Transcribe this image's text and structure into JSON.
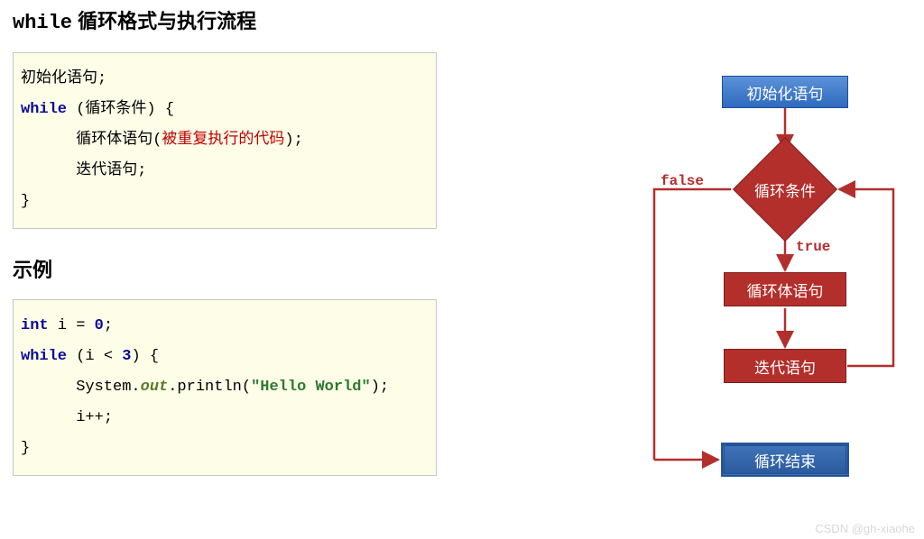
{
  "title": {
    "mono": "while",
    "rest": " 循环格式与执行流程"
  },
  "code1": {
    "l1": "初始化语句;",
    "kw": "while",
    "l2a": " (循环条件) {",
    "l3a": "      循环体语句(",
    "l3red": "被重复执行的代码",
    "l3b": ");",
    "l4": "      迭代语句;",
    "l5": "}"
  },
  "subTitle": "示例",
  "code2": {
    "kwInt": "int",
    "l1a": " i = ",
    "num0": "0",
    "semi": ";",
    "kwWhile": "while",
    "l2a": " (i < ",
    "num3": "3",
    "l2b": ") {",
    "l3a": "      System.",
    "l3out": "out",
    "l3b": ".println(",
    "l3str": "\"Hello World\"",
    "l3c": ");",
    "l4": "      i++;",
    "l5": "}"
  },
  "flow": {
    "init": "初始化语句",
    "cond": "循环条件",
    "body": "循环体语句",
    "iter": "迭代语句",
    "end": "循环结束",
    "trueLabel": "true",
    "falseLabel": "false"
  },
  "watermark": "CSDN @gh-xiaohe",
  "chart_data": {
    "type": "flowchart",
    "nodes": [
      {
        "id": "init",
        "label": "初始化语句",
        "shape": "rect",
        "style": "blue"
      },
      {
        "id": "cond",
        "label": "循环条件",
        "shape": "diamond",
        "style": "red"
      },
      {
        "id": "body",
        "label": "循环体语句",
        "shape": "rect",
        "style": "red"
      },
      {
        "id": "iter",
        "label": "迭代语句",
        "shape": "rect",
        "style": "red"
      },
      {
        "id": "end",
        "label": "循环结束",
        "shape": "rect",
        "style": "blue"
      }
    ],
    "edges": [
      {
        "from": "init",
        "to": "cond",
        "label": ""
      },
      {
        "from": "cond",
        "to": "body",
        "label": "true"
      },
      {
        "from": "body",
        "to": "iter",
        "label": ""
      },
      {
        "from": "iter",
        "to": "cond",
        "label": ""
      },
      {
        "from": "cond",
        "to": "end",
        "label": "false"
      }
    ]
  }
}
